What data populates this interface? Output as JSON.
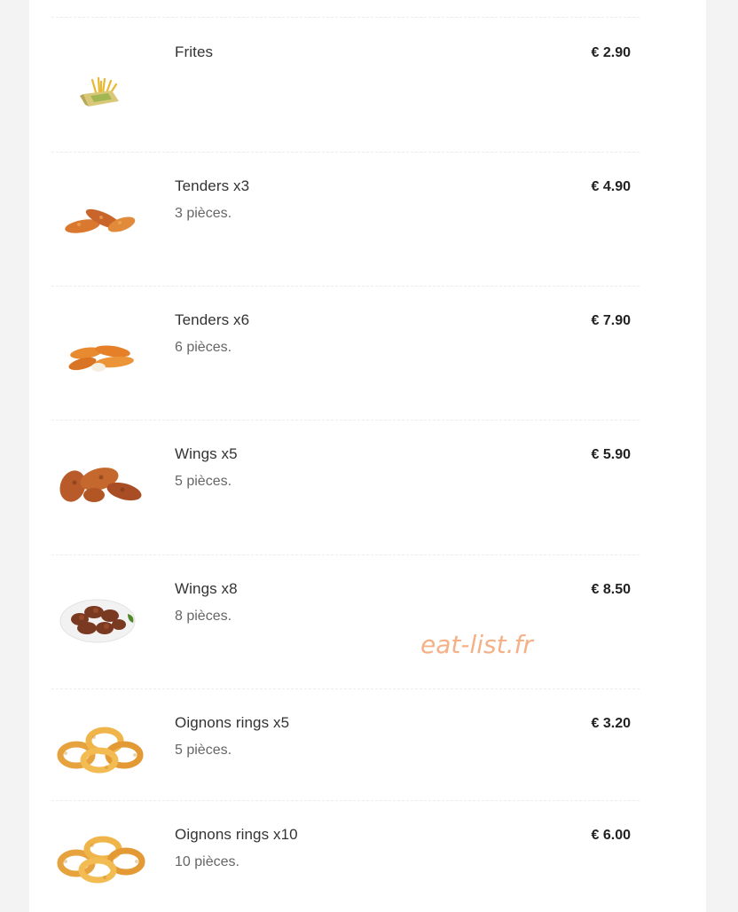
{
  "menu": {
    "items": [
      {
        "name": "Frites",
        "description": "",
        "price": "€ 2.90",
        "image_icon": "fries-icon"
      },
      {
        "name": "Tenders x3",
        "description": "3 pièces.",
        "price": "€ 4.90",
        "image_icon": "chicken-tenders-icon"
      },
      {
        "name": "Tenders x6",
        "description": "6 pièces.",
        "price": "€ 7.90",
        "image_icon": "chicken-tenders-icon"
      },
      {
        "name": "Wings x5",
        "description": "5 pièces.",
        "price": "€ 5.90",
        "image_icon": "chicken-wings-icon"
      },
      {
        "name": "Wings x8",
        "description": "8 pièces.",
        "price": "€ 8.50",
        "image_icon": "chicken-wings-plate-icon"
      },
      {
        "name": "Oignons rings x5",
        "description": "5 pièces.",
        "price": "€ 3.20",
        "image_icon": "onion-rings-icon"
      },
      {
        "name": "Oignons rings x10",
        "description": "10 pièces.",
        "price": "€ 6.00",
        "image_icon": "onion-rings-icon"
      }
    ]
  },
  "watermark": "eat-list.fr",
  "colors": {
    "page_background": "#f3f3f3",
    "panel_background": "#ffffff",
    "watermark": "#f4a87a"
  }
}
